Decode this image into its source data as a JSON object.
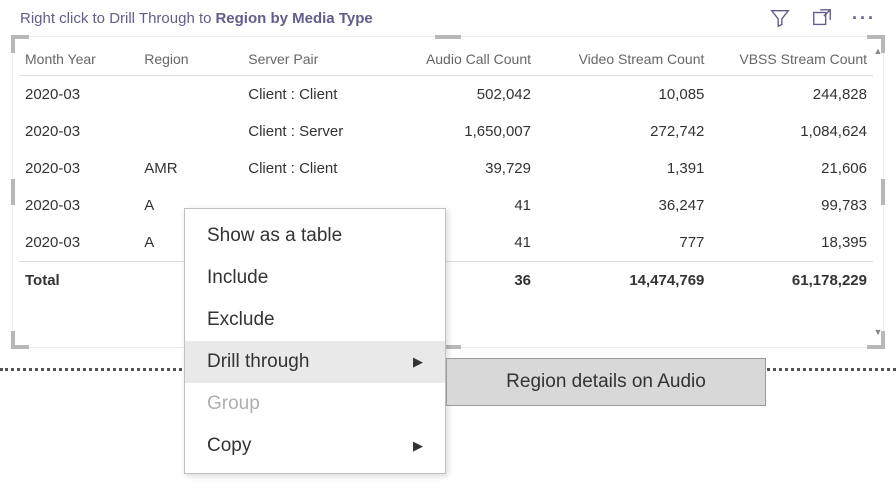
{
  "topbar": {
    "hint_prefix": "Right click to Drill Through to",
    "hint_bold": "Region by Media Type"
  },
  "columns": {
    "month": "Month Year",
    "region": "Region",
    "pair": "Server Pair",
    "audio": "Audio Call Count",
    "video": "Video Stream Count",
    "vbss": "VBSS Stream Count"
  },
  "rows": [
    {
      "month": "2020-03",
      "region": "",
      "pair": "Client : Client",
      "audio": "502,042",
      "video": "10,085",
      "vbss": "244,828"
    },
    {
      "month": "2020-03",
      "region": "",
      "pair": "Client : Server",
      "audio": "1,650,007",
      "video": "272,742",
      "vbss": "1,084,624"
    },
    {
      "month": "2020-03",
      "region": "AMR",
      "pair": "Client : Client",
      "audio": "39,729",
      "video": "1,391",
      "vbss": "21,606"
    },
    {
      "month": "2020-03",
      "region": "A",
      "pair": "",
      "audio": "41",
      "video": "36,247",
      "vbss": "99,783"
    },
    {
      "month": "2020-03",
      "region": "A",
      "pair": "",
      "audio": "41",
      "video": "777",
      "vbss": "18,395"
    }
  ],
  "total": {
    "label": "Total",
    "audio": "36",
    "video": "14,474,769",
    "vbss": "61,178,229"
  },
  "context_menu": {
    "show_table": "Show as a table",
    "include": "Include",
    "exclude": "Exclude",
    "drill": "Drill through",
    "group": "Group",
    "copy": "Copy"
  },
  "submenu": {
    "region_audio": "Region details on Audio"
  }
}
